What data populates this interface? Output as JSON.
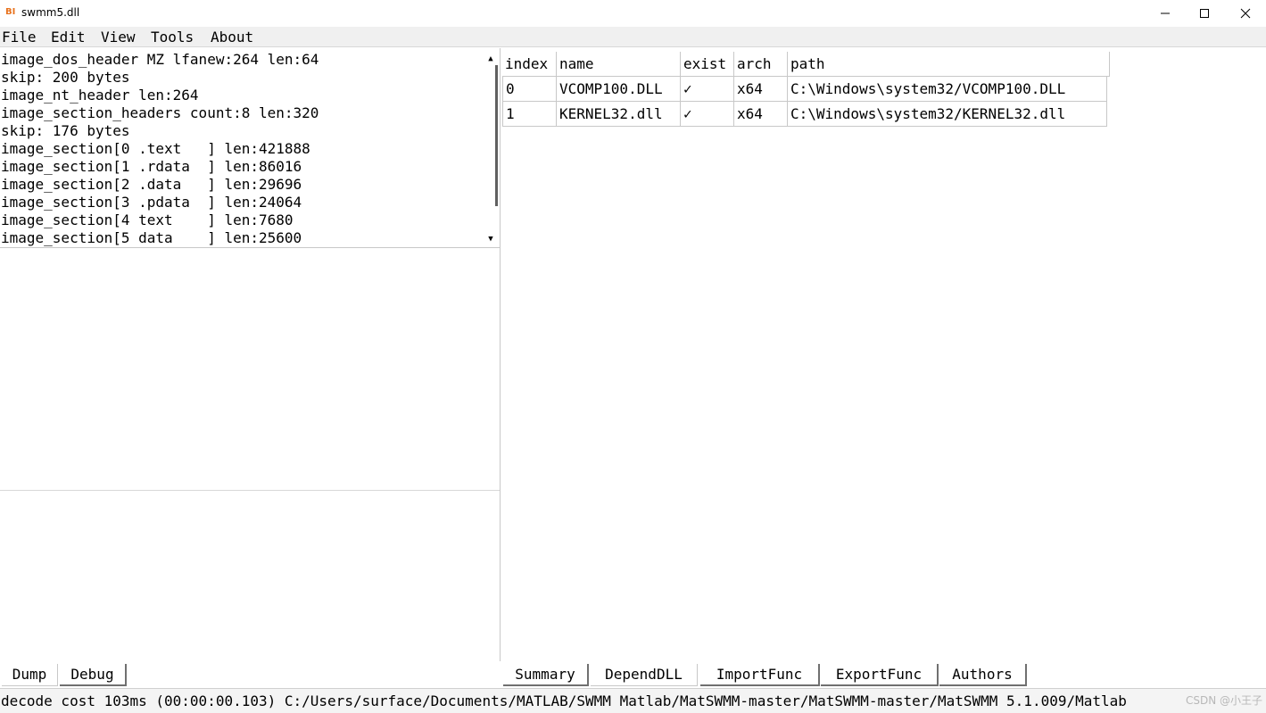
{
  "window": {
    "icon_text": "BI",
    "title": "swmm5.dll"
  },
  "menu": [
    "File",
    "Edit",
    "View",
    "Tools",
    "About"
  ],
  "dump": {
    "lines": [
      "image_dos_header MZ lfanew:264 len:64",
      "skip: 200 bytes",
      "image_nt_header len:264",
      "image_section_headers count:8 len:320",
      "skip: 176 bytes",
      "image_section[0 .text   ] len:421888",
      "image_section[1 .rdata  ] len:86016",
      "image_section[2 .data   ] len:29696",
      "image_section[3 .pdata  ] len:24064",
      "image_section[4 text    ] len:7680",
      "image_section[5 data    ] len:25600"
    ]
  },
  "left_tabs": [
    {
      "label": "Dump",
      "active": true
    },
    {
      "label": "Debug",
      "active": false
    }
  ],
  "depend_table": {
    "columns": [
      "index",
      "name",
      "exist",
      "arch",
      "path"
    ],
    "rows": [
      [
        "0",
        "VCOMP100.DLL",
        "✓",
        "x64",
        "C:\\Windows\\system32/VCOMP100.DLL"
      ],
      [
        "1",
        "KERNEL32.dll",
        "✓",
        "x64",
        "C:\\Windows\\system32/KERNEL32.dll"
      ]
    ]
  },
  "right_tabs": [
    {
      "label": "Summary",
      "active": false
    },
    {
      "label": "DependDLL",
      "active": true
    },
    {
      "label": "ImportFunc",
      "active": false
    },
    {
      "label": "ExportFunc",
      "active": false
    },
    {
      "label": "Authors",
      "active": false
    }
  ],
  "status": {
    "text": "decode cost 103ms (00:00:00.103) C:/Users/surface/Documents/MATLAB/SWMM Matlab/MatSWMM-master/MatSWMM-master/MatSWMM 5.1.009/Matlab",
    "watermark": "CSDN @小王子"
  },
  "colors": {
    "accent_icon": "#e8731f",
    "grid_line": "#c8c8c8",
    "menu_bg": "#f0f0f0"
  }
}
